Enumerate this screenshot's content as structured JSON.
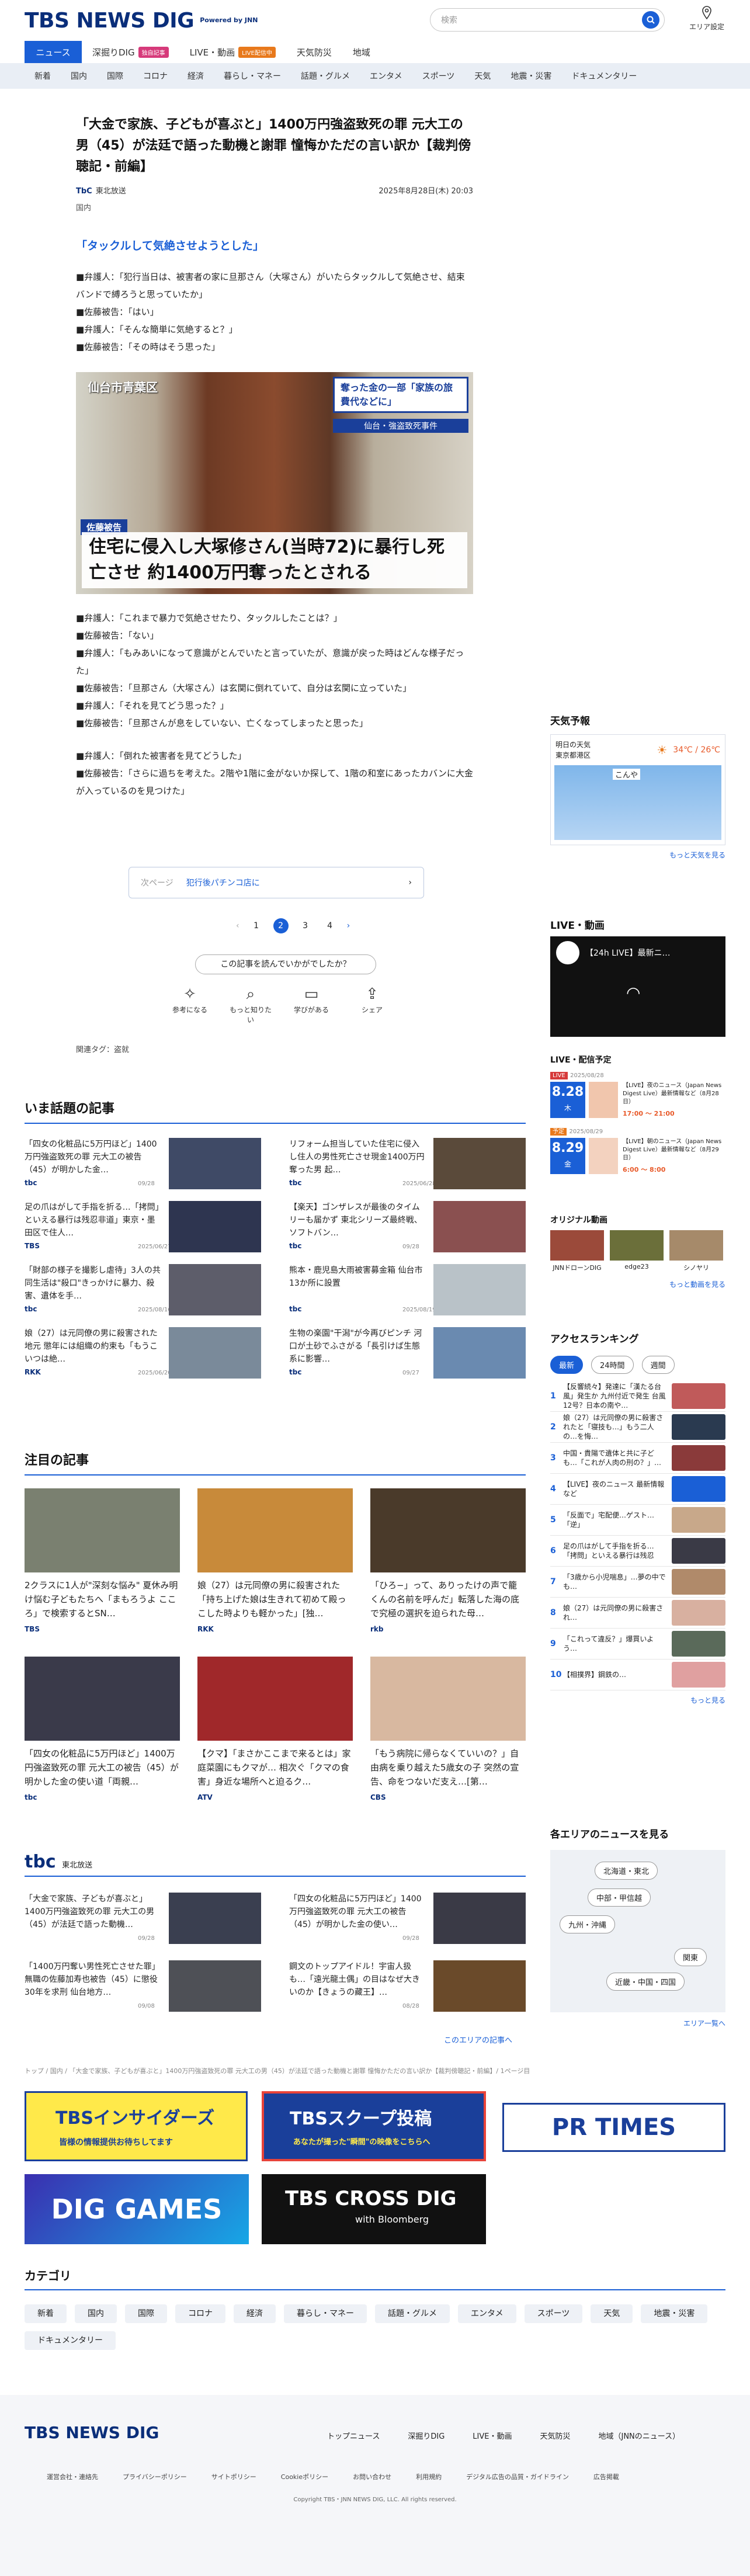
{
  "header": {
    "logo": "TBS NEWS DIG",
    "powered": "Powered by JNN",
    "search_placeholder": "検索",
    "area_setting": "エリア設定"
  },
  "nav1": [
    {
      "label": "ニュース"
    },
    {
      "label": "深掘りDIG",
      "badge": "独自記事"
    },
    {
      "label": "LIVE・動画",
      "badge": "LIVE配信中"
    },
    {
      "label": "天気防災"
    },
    {
      "label": "地域"
    }
  ],
  "nav2": [
    "新着",
    "国内",
    "国際",
    "コロナ",
    "経済",
    "暮らし・マネー",
    "話題・グルメ",
    "エンタメ",
    "スポーツ",
    "天気",
    "地震・災害",
    "ドキュメンタリー"
  ],
  "article": {
    "title": "「大金で家族、子どもが喜ぶと」1400万円強盗致死の罪 元大工の男（45）が法廷で語った動機と謝罪 憧悔かただの言い訳か【裁判傍聴記・前編】",
    "source": "東北放送",
    "date": "2025年8月28日(木) 20:03",
    "category": "国内",
    "subheading": "「タックルして気絶させようとした」",
    "para1": [
      "■弁護人：「犯行当日は、被害者の家に旦那さん（大塚さん）がいたらタックルして気絶させ、結束バンドで縛ろうと思っていたか」",
      "■佐藤被告：「はい」",
      "■弁護人：「そんな簡単に気絶すると？」",
      "■佐藤被告：「その時はそう思った」"
    ],
    "photo": {
      "location": "仙台市青葉区",
      "tag": "佐藤被告",
      "side": "奪った金の一部「家族の旅費代などに」",
      "case": "仙台・強盗致死事件",
      "caption": "住宅に侵入し大塚修さん(当時72)に暴行し死亡させ 約1400万円奪ったとされる"
    },
    "para2": [
      "■弁護人：「これまで暴力で気絶させたり、タックルしたことは？」",
      "■佐藤被告：「ない」",
      "■弁護人：「もみあいになって意識がとんでいたと言っていたが、意識が戻った時はどんな様子だった」",
      "■佐藤被告：「旦那さん（大塚さん）は玄関に倒れていて、自分は玄関に立っていた」",
      "■弁護人：「それを見てどう思った？」",
      "■佐藤被告：「旦那さんが息をしていない、亡くなってしまったと思った」"
    ],
    "para3": [
      "■弁護人：「倒れた被害者を見てどうした」",
      "■佐藤被告：「さらに過ちを考えた。2階や1階に金がないか探して、1階の和室にあったカバンに大金が入っているのを見つけた」"
    ],
    "next_label": "次ページ",
    "next_title": "犯行後パチンコ店に",
    "pages": [
      "1",
      "2",
      "3",
      "4"
    ],
    "feedback": "この記事を読んでいかがでしたか？",
    "reactions": [
      "参考になる",
      "もっと知りたい",
      "学びがある",
      "シェア"
    ],
    "tags": "関連タグ：盗就"
  },
  "sidebar": {
    "weather_title": "天気予報",
    "weather_when": "明日の天気",
    "weather_place": "東京都港区",
    "weather_temp": "34℃ / 26℃",
    "weather_map_label": "こんや",
    "weather_more": "もっと天気を見る",
    "live_title": "LIVE・動画",
    "live_video": "【24h LIVE】最新ニ…",
    "sched_title": "LIVE・配信予定",
    "sched": [
      {
        "date": "2025/08/28",
        "badge": "LIVE",
        "day": "8.28",
        "dow": "木",
        "text": "【LIVE】夜のニュース（Japan News Digest Live）最新情報など（8月28日）",
        "time": "17:00 〜 21:00"
      },
      {
        "date": "2025/08/29",
        "badge": "予定",
        "day": "8.29",
        "dow": "金",
        "text": "【LIVE】朝のニュース（Japan News Digest Live）最新情報など（8月29日）",
        "time": "6:00 〜 8:00"
      }
    ],
    "orig_title": "オリジナル動画",
    "orig": [
      "JNNドローンDIG",
      "edge23",
      "シノヤリ"
    ],
    "orig_more": "もっと動画を見る",
    "rank_title": "アクセスランキング",
    "rank_tabs": [
      "最新",
      "24時間",
      "週間"
    ],
    "rank": [
      "【反響続々】発達に「漢たる台風」発生か 九州付近で発生 台風12号？日本の南や…",
      "娘（27）は元同僚の男に殺害されたと「寝技も…」もう二人の…を悔…",
      "中国・貴陽で遺体と共に子ども…「これが人肉の刑の？」…",
      "【LIVE】夜のニュース 最新情報など",
      "「反面で」宅配便…ゲスト…「逆」",
      "足の爪はがして手指を折る…「拷問」といえる暴行は残忍",
      "「3歳から小児喘息」…夢の中でも…",
      "娘（27）は元同僚の男に殺害され…",
      "「これって違反？」爆買いよう…",
      "【相撲界】鋼鉄の…"
    ],
    "rank_more": "もっと見る",
    "area_title": "各エリアのニュースを見る",
    "areas": [
      "北海道・東北",
      "中部・甲信越",
      "九州・沖縄",
      "関東",
      "近畿・中国・四国"
    ],
    "area_more": "エリア一覧へ"
  },
  "popular": {
    "title": "いま話題の記事",
    "items": [
      {
        "text": "「四女の化粧品に5万円ほど」1400万円強盗致死の罪 元大工の被告（45）が明かした金…",
        "src": "tbc",
        "date": "09/28"
      },
      {
        "text": "リフォーム担当していた住宅に侵入し住人の男性死亡させ現金1400万円奪った男 起…",
        "src": "tbc",
        "date": "2025/06/28"
      },
      {
        "text": "足の爪はがして手指を折る…「拷問」といえる暴行は残忍非道」東京・墨田区で住人…",
        "src": "TBS",
        "date": "2025/06/27"
      },
      {
        "text": "【楽天】ゴンザレスが最後のタイムリーも届かず 東北シリーズ最終戦、ソフトバン…",
        "src": "tbc",
        "date": "09/28"
      },
      {
        "text": "「財部の様子を撮影し虐待」3人の共同生活は\"殺口\"きっかけに暴力、殺害、遺体を手…",
        "src": "tbc",
        "date": "2025/08/16"
      },
      {
        "text": "熊本・鹿児島大雨被害募金箱 仙台市13か所に設置",
        "src": "tbc",
        "date": "2025/08/19"
      },
      {
        "text": "娘（27）は元同僚の男に殺害された地元 懲年には組織の約束も「もうこいつは絶…",
        "src": "RKK",
        "date": "2025/06/20"
      },
      {
        "text": "生物の楽園\"干潟\"が今再びピンチ 河口が土砂でふさがる「長引けば生態系に影響…",
        "src": "tbc",
        "date": "09/27"
      }
    ]
  },
  "featured": {
    "title": "注目の記事",
    "items": [
      {
        "text": "2クラスに1人が\"深刻な悩み\" 夏休み明け悩む子どもたちへ「まもろうよ こころ」で検索するとSN…",
        "src": "TBS",
        "date": "08/28"
      },
      {
        "text": "娘（27）は元同僚の男に殺害された「持ち上げた娘は生きれて初めて殿っこした時よりも軽かった」[独…",
        "src": "RKK",
        "date": "2025/06/27"
      },
      {
        "text": "「ひろ−」って、ありったけの声で籠くんの名前を呼んだ」転落した海の底で究極の選択を迫られた母…",
        "src": "rkb",
        "date": "2025/06/20"
      },
      {
        "text": "「四女の化粧品に5万円ほど」1400万円強盗致死の罪 元大工の被告（45）が明かした金の使い道「両親…",
        "src": "tbc",
        "date": "09/28"
      },
      {
        "text": "【クマ】「まさかここまで来るとは」家庭菜園にもクマが… 相次ぐ「クマの食害」身近な場所へと迫るク…",
        "src": "ATV",
        "date": "08/28"
      },
      {
        "text": "「もう病院に帰らなくていいの？」自由病を乗り越えた5歳女の子 突然の宣告、命をつないだ支え…[第…",
        "src": "CBS",
        "date": "2025/06/27"
      }
    ]
  },
  "local": {
    "name": "東北放送",
    "items": [
      {
        "text": "「大金で家族、子どもが喜ぶと」1400万円強盗致死の罪 元大工の男（45）が法廷で語った動機…",
        "date": "09/28"
      },
      {
        "text": "「四女の化粧品に5万円ほど」1400万円強盗致死の罪 元大工の被告（45）が明かした金の使い…",
        "date": "09/28"
      },
      {
        "text": "「1400万円奪い男性死亡させた罪」無職の佐藤加寿也被告（45）に懲役30年を求刑 仙台地方…",
        "date": "09/08"
      },
      {
        "text": "鋼文のトップアイドル！宇宙人扱も…「遠光龍土偶」の目はなぜ大きいのか【きょうの藏王】…",
        "date": "08/28"
      }
    ],
    "more": "このエリアの記事へ"
  },
  "breadcrumb": "トップ / 国内 / 「大金で家族、子どもが喜ぶと」1400万円強盗致死の罪 元大工の男（45）が法廷で語った動機と謝罪 憧悔かただの言い訳か【裁判傍聴記・前編】/ 1ページ目",
  "banners": {
    "insider": "TBSインサイダーズ",
    "insider_sub": "皆様の情報提供お待ちしてます",
    "scoop": "TBSスクープ投稿",
    "scoop_sub": "あなたが撮った\"瞬間\"の映像をこちらへ",
    "prtimes": "PR TIMES",
    "games": "DIG GAMES",
    "cross": "TBS CROSS DIG",
    "cross_sub": "with Bloomberg"
  },
  "categories": {
    "title": "カテゴリ",
    "items": [
      "新着",
      "国内",
      "国際",
      "コロナ",
      "経済",
      "暮らし・マネー",
      "話題・グルメ",
      "エンタメ",
      "スポーツ",
      "天気",
      "地震・災害",
      "ドキュメンタリー"
    ]
  },
  "footer": {
    "nav": [
      "トップニュース",
      "深掘りDIG",
      "LIVE・動画",
      "天気防災",
      "地域（JNNのニュース）"
    ],
    "links": [
      "運営会社・連絡先",
      "プライバシーポリシー",
      "サイトポリシー",
      "Cookieポリシー",
      "お問い合わせ",
      "利用規約",
      "デジタル広告の品質・ガイドライン",
      "広告掲載"
    ],
    "copyright": "Copyright TBS・JNN NEWS DIG, LLC. All rights reserved."
  },
  "colors": {
    "brand": "#0a2e7a",
    "accent": "#1a5fd6",
    "nav_bg": "#e9eef5"
  }
}
